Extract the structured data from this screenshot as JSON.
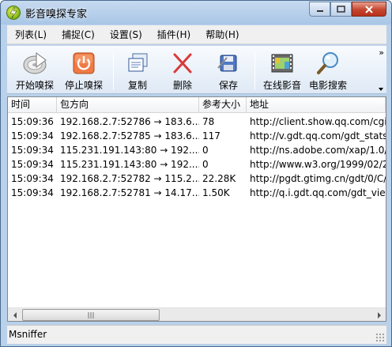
{
  "window": {
    "title": "影音嗅探专家"
  },
  "menu": [
    "列表(L)",
    "捕捉(C)",
    "设置(S)",
    "插件(H)",
    "帮助(H)"
  ],
  "toolbar": {
    "start_sniff": "开始嗅探",
    "stop_sniff": "停止嗅探",
    "copy": "复制",
    "delete": "删除",
    "save": "保存",
    "online_media": "在线影音",
    "movie_search": "电影搜索",
    "overflow": "»"
  },
  "table": {
    "columns": [
      "时间",
      "包方向",
      "参考大小",
      "地址"
    ],
    "rows": [
      [
        "15:09:36",
        "192.168.2.7:52786 → 183.6...",
        "78",
        "http://client.show.qq.com/cgi-"
      ],
      [
        "15:09:34",
        "192.168.2.7:52785 → 183.6...",
        "117",
        "http://v.gdt.qq.com/gdt_stats"
      ],
      [
        "15:09:34",
        "115.231.191.143:80 → 192....",
        "0",
        "http://ns.adobe.com/xap/1.0/"
      ],
      [
        "15:09:34",
        "115.231.191.143:80 → 192....",
        "0",
        "http://www.w3.org/1999/02/2"
      ],
      [
        "15:09:34",
        "192.168.2.7:52782 → 115.2...",
        "22.28K",
        "http://pgdt.gtimg.cn/gdt/0/C/"
      ],
      [
        "15:09:34",
        "192.168.2.7:52781 → 14.17....",
        "1.50K",
        "http://q.i.gdt.qq.com/gdt_view"
      ]
    ]
  },
  "statusbar": {
    "text": "Msniffer"
  },
  "colors": {
    "title_bg": "#b9d1ea",
    "close_red": "#c5452e",
    "stop_orange": "#e8622c",
    "delete_red": "#d83a3a"
  }
}
